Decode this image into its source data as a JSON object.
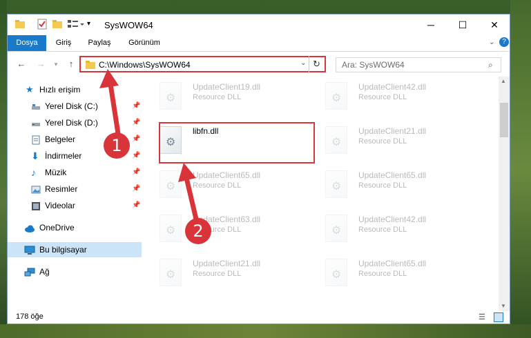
{
  "window": {
    "title": "SysWOW64",
    "minimize_glyph": "─",
    "maximize_glyph": "☐",
    "close_glyph": "✕"
  },
  "ribbon": {
    "tabs": [
      "Dosya",
      "Giriş",
      "Paylaş",
      "Görünüm"
    ],
    "active": "Dosya"
  },
  "address": {
    "path": "C:\\Windows\\SysWOW64",
    "search_placeholder": "Ara: SysWOW64"
  },
  "nav": [
    {
      "label": "Hızlı erişim",
      "icon": "star-icon",
      "pinned": false
    },
    {
      "label": "Yerel Disk (C:)",
      "icon": "drive-icon",
      "pinned": true
    },
    {
      "label": "Yerel Disk (D:)",
      "icon": "drive-icon",
      "pinned": true
    },
    {
      "label": "Belgeler",
      "icon": "documents-icon",
      "pinned": true
    },
    {
      "label": "İndirmeler",
      "icon": "download-icon",
      "pinned": true
    },
    {
      "label": "Müzik",
      "icon": "music-icon",
      "pinned": true
    },
    {
      "label": "Resimler",
      "icon": "pictures-icon",
      "pinned": true
    },
    {
      "label": "Videolar",
      "icon": "videos-icon",
      "pinned": true
    },
    {
      "label": "OneDrive",
      "icon": "cloud-icon",
      "pinned": false
    },
    {
      "label": "Bu bilgisayar",
      "icon": "computer-icon",
      "pinned": false
    },
    {
      "label": "Ağ",
      "icon": "network-icon",
      "pinned": false
    }
  ],
  "files_left": [
    {
      "name": "UpdateClient19.dll",
      "type": "Resource DLL"
    },
    {
      "name": "libfn.dll",
      "type": ""
    },
    {
      "name": "UpdateClient65.dll",
      "type": "Resource DLL"
    },
    {
      "name": "UpdateClient63.dll",
      "type": "Resource DLL"
    },
    {
      "name": "UpdateClient21.dll",
      "type": "Resource DLL"
    }
  ],
  "files_right": [
    {
      "name": "UpdateClient42.dll",
      "type": "Resource DLL"
    },
    {
      "name": "UpdateClient21.dll",
      "type": "Resource DLL"
    },
    {
      "name": "UpdateClient65.dll",
      "type": "Resource DLL"
    },
    {
      "name": "UpdateClient42.dll",
      "type": "Resource DLL"
    },
    {
      "name": "UpdateClient65.dll",
      "type": "Resource DLL"
    }
  ],
  "status": {
    "count": "178 öğe"
  },
  "annotations": {
    "step1": "1",
    "step2": "2"
  },
  "colors": {
    "accent": "#1979ca",
    "highlight": "#d8343a"
  }
}
